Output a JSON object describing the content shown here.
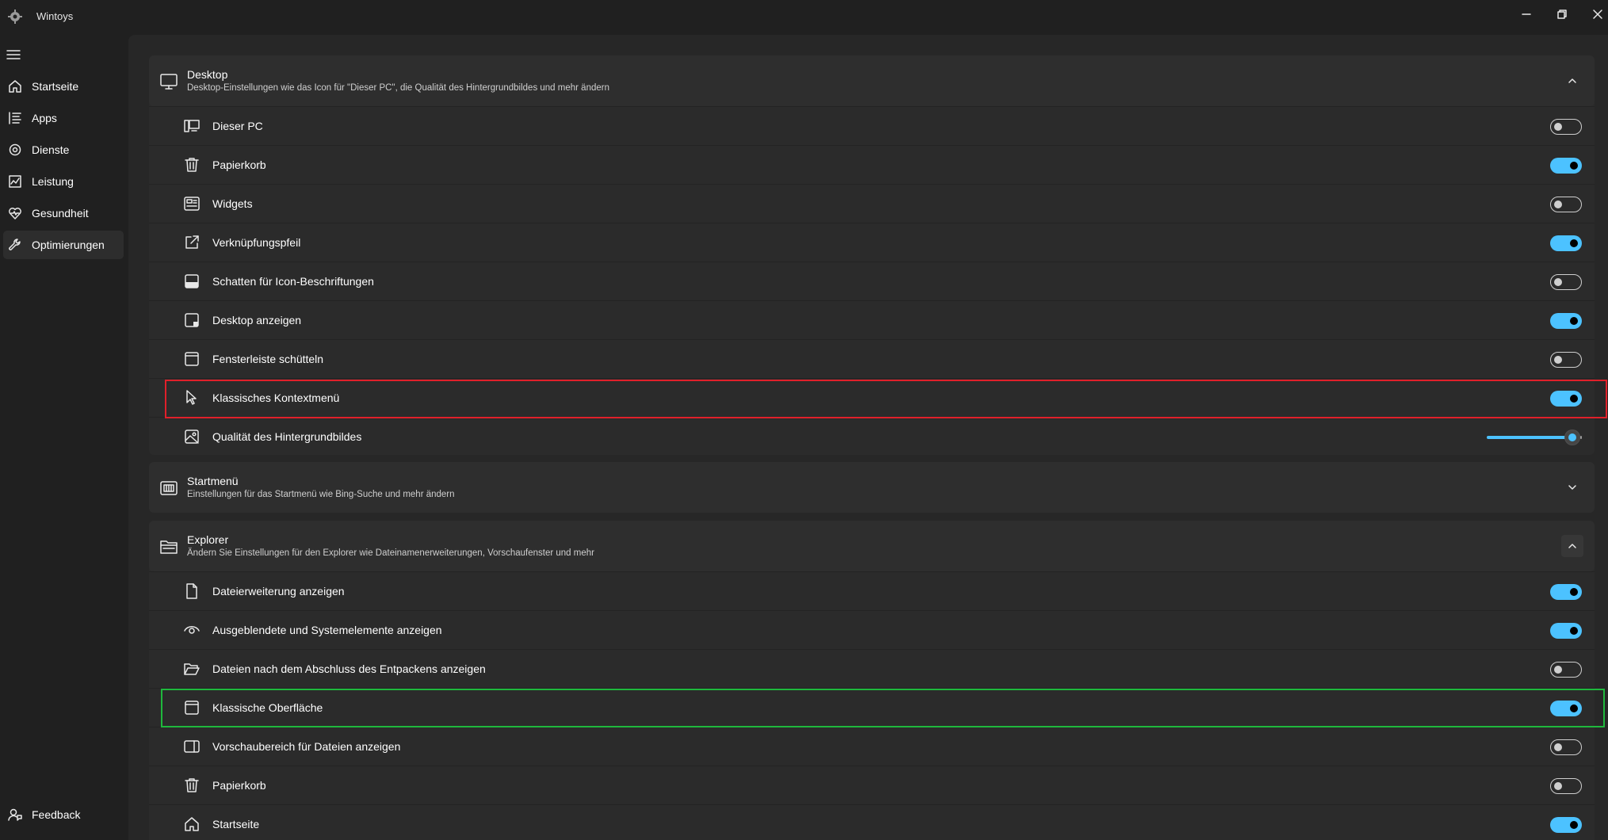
{
  "window": {
    "title": "Wintoys"
  },
  "sidebar": {
    "items": [
      {
        "label": "Startseite",
        "icon": "home-icon"
      },
      {
        "label": "Apps",
        "icon": "apps-list-icon"
      },
      {
        "label": "Dienste",
        "icon": "services-gear-icon"
      },
      {
        "label": "Leistung",
        "icon": "performance-chart-icon"
      },
      {
        "label": "Gesundheit",
        "icon": "health-heart-icon"
      },
      {
        "label": "Optimierungen",
        "icon": "wrench-icon"
      }
    ],
    "active_item": "Optimierungen",
    "footer_label": "Feedback"
  },
  "sections": {
    "desktop": {
      "title": "Desktop",
      "subtitle": "Desktop-Einstellungen wie das Icon für \"Dieser PC\", die Qualität des Hintergrundbildes und mehr ändern",
      "expanded": true,
      "rows": [
        {
          "label": "Dieser PC",
          "icon": "this-pc-icon",
          "on": false
        },
        {
          "label": "Papierkorb",
          "icon": "recycle-bin-icon",
          "on": true
        },
        {
          "label": "Widgets",
          "icon": "widgets-icon",
          "on": false
        },
        {
          "label": "Verknüpfungspfeil",
          "icon": "shortcut-arrow-icon",
          "on": true
        },
        {
          "label": "Schatten für Icon-Beschriftungen",
          "icon": "shadow-icon",
          "on": false
        },
        {
          "label": "Desktop anzeigen",
          "icon": "show-desktop-icon",
          "on": true
        },
        {
          "label": "Fensterleiste schütteln",
          "icon": "window-shake-icon",
          "on": false
        },
        {
          "label": "Klassisches Kontextmenü",
          "icon": "cursor-icon",
          "on": true
        },
        {
          "label": "Qualität des Hintergrundbildes",
          "icon": "wallpaper-image-icon",
          "slider_fraction": 0.9
        }
      ]
    },
    "startmenu": {
      "title": "Startmenü",
      "subtitle": "Einstellungen für das Startmenü wie Bing-Suche und mehr ändern",
      "expanded": false
    },
    "explorer": {
      "title": "Explorer",
      "subtitle": "Ändern Sie Einstellungen für den Explorer wie Dateinamenerweiterungen, Vorschaufenster und mehr",
      "expanded": true,
      "rows": [
        {
          "label": "Dateierweiterung anzeigen",
          "icon": "file-icon",
          "on": true
        },
        {
          "label": "Ausgeblendete und Systemelemente anzeigen",
          "icon": "eye-icon",
          "on": true
        },
        {
          "label": "Dateien nach dem Abschluss des Entpackens anzeigen",
          "icon": "folder-open-icon",
          "on": false
        },
        {
          "label": "Klassische Oberfläche",
          "icon": "window-icon",
          "on": true
        },
        {
          "label": "Vorschaubereich für Dateien anzeigen",
          "icon": "preview-pane-icon",
          "on": false
        },
        {
          "label": "Papierkorb",
          "icon": "recycle-bin-icon",
          "on": false
        },
        {
          "label": "Startseite",
          "icon": "home-icon",
          "on": true
        }
      ]
    }
  },
  "colors": {
    "accent": "#4cc2ff",
    "highlight_red": "#e0202a",
    "highlight_green": "#1fb83d"
  }
}
